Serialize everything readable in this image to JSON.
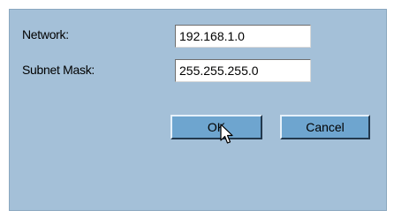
{
  "dialog": {
    "network_label": "Network:",
    "network_value": "192.168.1.0",
    "subnet_label": "Subnet Mask:",
    "subnet_value": "255.255.255.0",
    "ok_label": "OK",
    "cancel_label": "Cancel"
  },
  "colors": {
    "dialog_background": "#a4c0d8",
    "button_face": "#6ea5cf"
  },
  "icons": {
    "cursor": "mouse-pointer-icon"
  }
}
